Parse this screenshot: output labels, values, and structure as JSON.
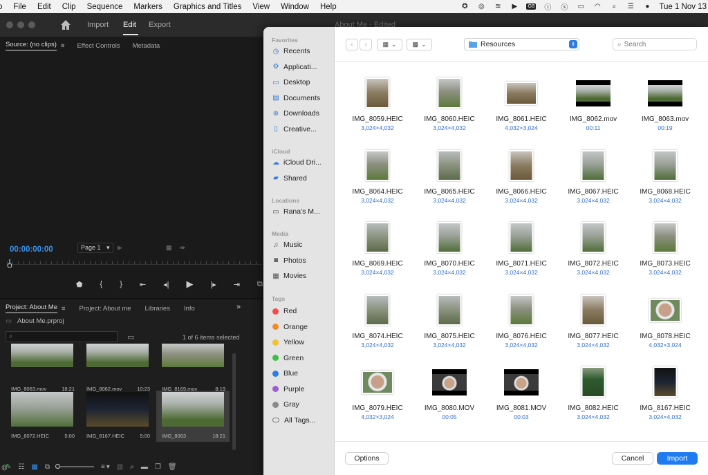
{
  "menubar": {
    "items": [
      "o",
      "File",
      "Edit",
      "Clip",
      "Sequence",
      "Markers",
      "Graphics and Titles",
      "View",
      "Window",
      "Help"
    ],
    "gb_badge": "GB",
    "clock": "Tue 1 Nov 13"
  },
  "app": {
    "workspace_tabs": [
      "Import",
      "Edit",
      "Export"
    ],
    "active_tab": "Edit",
    "document_title": "About Me - Edited",
    "source_tabs": [
      "Source: (no clips)",
      "Effect Controls",
      "Metadata"
    ],
    "timecode": "00:00:00:00",
    "page_select": "Page 1",
    "project_tabs": [
      "Project: About Me",
      "Project: About me",
      "Libraries",
      "Info"
    ],
    "project_file": "About Me.prproj",
    "selection_count": "1 of 6 items selected",
    "clips": [
      {
        "name": "IMG_8063.mov",
        "duration": "18:21",
        "style": "gradwide"
      },
      {
        "name": "IMG_8062.mov",
        "duration": "10:23",
        "style": "gradwide"
      },
      {
        "name": "IMG_8169.mov",
        "duration": "8:19",
        "style": "gradpark"
      },
      {
        "name": "IMG_8072.HEIC",
        "duration": "5:00",
        "style": "bandstand"
      },
      {
        "name": "IMG_8167.HEIC",
        "duration": "5:00",
        "style": "gradnight"
      },
      {
        "name": "IMG_8063",
        "duration": "18:21",
        "style": "gradwide"
      }
    ]
  },
  "dialog": {
    "sidebar": {
      "favorites_header": "Favorites",
      "favorites": [
        {
          "label": "Recents",
          "icon": "clock-icon"
        },
        {
          "label": "Applicati...",
          "icon": "applications-icon"
        },
        {
          "label": "Desktop",
          "icon": "desktop-icon"
        },
        {
          "label": "Documents",
          "icon": "document-icon"
        },
        {
          "label": "Downloads",
          "icon": "download-icon"
        },
        {
          "label": "Creative...",
          "icon": "file-icon"
        }
      ],
      "icloud_header": "iCloud",
      "icloud": [
        {
          "label": "iCloud Dri...",
          "icon": "cloud-icon"
        },
        {
          "label": "Shared",
          "icon": "shared-folder-icon"
        }
      ],
      "locations_header": "Locations",
      "locations": [
        {
          "label": "Rana's M...",
          "icon": "laptop-icon"
        }
      ],
      "media_header": "Media",
      "media": [
        {
          "label": "Music",
          "icon": "music-icon"
        },
        {
          "label": "Photos",
          "icon": "camera-icon"
        },
        {
          "label": "Movies",
          "icon": "film-icon"
        }
      ],
      "tags_header": "Tags",
      "tags": [
        {
          "label": "Red",
          "color": "#f24b4b"
        },
        {
          "label": "Orange",
          "color": "#f28a28"
        },
        {
          "label": "Yellow",
          "color": "#f2c12e"
        },
        {
          "label": "Green",
          "color": "#3fbf4a"
        },
        {
          "label": "Blue",
          "color": "#2e7be4"
        },
        {
          "label": "Purple",
          "color": "#a15bd4"
        },
        {
          "label": "Gray",
          "color": "#8a8a8a"
        },
        {
          "label": "All Tags...",
          "color": ""
        }
      ]
    },
    "location": "Resources",
    "search_placeholder": "Search",
    "files": [
      {
        "name": "IMG_8059.HEIC",
        "meta": "3,024×4,032",
        "kind": "port",
        "style": "tree"
      },
      {
        "name": "IMG_8060.HEIC",
        "meta": "3,024×4,032",
        "kind": "port",
        "style": "gradpark"
      },
      {
        "name": "IMG_8061.HEIC",
        "meta": "4,032×3,024",
        "kind": "land",
        "style": "tree"
      },
      {
        "name": "IMG_8062.mov",
        "meta": "00:11",
        "kind": "video",
        "style": "gradwide"
      },
      {
        "name": "IMG_8063.mov",
        "meta": "00:19",
        "kind": "video",
        "style": "gradwide"
      },
      {
        "name": "IMG_8064.HEIC",
        "meta": "3,024×4,032",
        "kind": "port",
        "style": "gradpark"
      },
      {
        "name": "IMG_8065.HEIC",
        "meta": "3,024×4,032",
        "kind": "port",
        "style": "wet"
      },
      {
        "name": "IMG_8066.HEIC",
        "meta": "3,024×4,032",
        "kind": "port",
        "style": "tree"
      },
      {
        "name": "IMG_8067.HEIC",
        "meta": "3,024×4,032",
        "kind": "port",
        "style": "bandstand"
      },
      {
        "name": "IMG_8068.HEIC",
        "meta": "3,024×4,032",
        "kind": "port",
        "style": "bandstand"
      },
      {
        "name": "IMG_8069.HEIC",
        "meta": "3,024×4,032",
        "kind": "port",
        "style": "wet"
      },
      {
        "name": "IMG_8070.HEIC",
        "meta": "3,024×4,032",
        "kind": "port",
        "style": "bandstand"
      },
      {
        "name": "IMG_8071.HEIC",
        "meta": "3,024×4,032",
        "kind": "port",
        "style": "bandstand"
      },
      {
        "name": "IMG_8072.HEIC",
        "meta": "3,024×4,032",
        "kind": "port",
        "style": "bandstand"
      },
      {
        "name": "IMG_8073.HEIC",
        "meta": "3,024×4,032",
        "kind": "port",
        "style": "gradpark"
      },
      {
        "name": "IMG_8074.HEIC",
        "meta": "3,024×4,032",
        "kind": "port",
        "style": "wet"
      },
      {
        "name": "IMG_8075.HEIC",
        "meta": "3,024×4,032",
        "kind": "port",
        "style": "wet"
      },
      {
        "name": "IMG_8076.HEIC",
        "meta": "3,024×4,032",
        "kind": "port",
        "style": "gradpark"
      },
      {
        "name": "IMG_8077.HEIC",
        "meta": "3,024×4,032",
        "kind": "port",
        "style": "tree"
      },
      {
        "name": "IMG_8078.HEIC",
        "meta": "4,032×3,024",
        "kind": "land",
        "style": "face"
      },
      {
        "name": "IMG_8079.HEIC",
        "meta": "4,032×3,024",
        "kind": "land",
        "style": "face"
      },
      {
        "name": "IMG_8080.MOV",
        "meta": "00:05",
        "kind": "video",
        "style": "face2"
      },
      {
        "name": "IMG_8081.MOV",
        "meta": "00:03",
        "kind": "video",
        "style": "face2"
      },
      {
        "name": "IMG_8082.HEIC",
        "meta": "3,024×4,032",
        "kind": "port",
        "style": "sign"
      },
      {
        "name": "IMG_8167.HEIC",
        "meta": "3,024×4,032",
        "kind": "port",
        "style": "gradnight"
      }
    ],
    "buttons": {
      "options": "Options",
      "cancel": "Cancel",
      "import": "Import"
    }
  }
}
